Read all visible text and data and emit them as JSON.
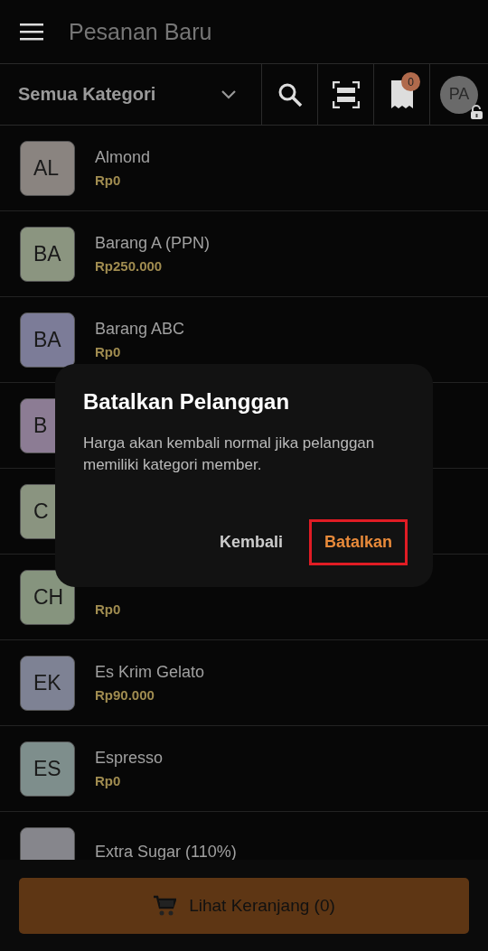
{
  "app_bar": {
    "title": "Pesanan Baru"
  },
  "toolbar": {
    "category": "Semua Kategori",
    "cart_badge": "0",
    "avatar": "PA"
  },
  "products": [
    {
      "initials": "AL",
      "name": "Almond",
      "price": "Rp0",
      "color": "#8a8480"
    },
    {
      "initials": "BA",
      "name": "Barang A (PPN)",
      "price": "Rp250.000",
      "color": "#8b9580"
    },
    {
      "initials": "BA",
      "name": "Barang ABC",
      "price": "Rp0",
      "color": "#7c7c98"
    },
    {
      "initials": "B",
      "color": "#8c7c94"
    },
    {
      "initials": "C",
      "color": "#8a9480"
    },
    {
      "initials": "CH",
      "price": "Rp0",
      "color": "#86947e"
    },
    {
      "initials": "EK",
      "name": "Es Krim Gelato",
      "price": "Rp90.000",
      "color": "#7e8294"
    },
    {
      "initials": "ES",
      "name": "Espresso",
      "price": "Rp0",
      "color": "#7e8e8c"
    },
    {
      "name": "Extra Sugar (110%)",
      "color": "#86868c"
    }
  ],
  "cart_button": {
    "label": "Lihat Keranjang (0)"
  },
  "dialog": {
    "title": "Batalkan Pelanggan",
    "message": "Harga akan kembali normal jika pelanggan memiliki kategori member.",
    "buttons": [
      {
        "label": "Kembali",
        "kind": "secondary",
        "highlighted": false
      },
      {
        "label": "Batalkan",
        "kind": "primary",
        "highlighted": true
      }
    ]
  }
}
